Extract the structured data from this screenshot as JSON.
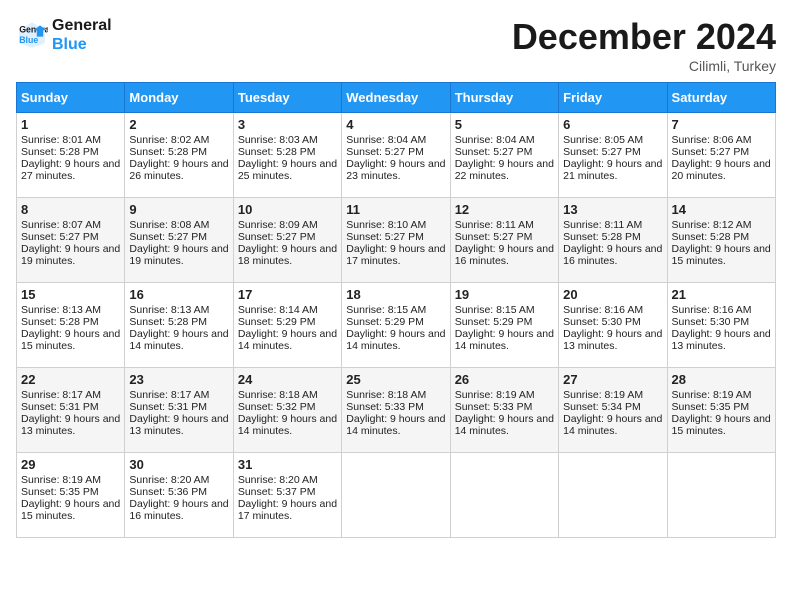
{
  "header": {
    "logo_line1": "General",
    "logo_line2": "Blue",
    "month": "December 2024",
    "location": "Cilimli, Turkey"
  },
  "weekdays": [
    "Sunday",
    "Monday",
    "Tuesday",
    "Wednesday",
    "Thursday",
    "Friday",
    "Saturday"
  ],
  "weeks": [
    [
      {
        "day": "1",
        "sr": "8:01 AM",
        "ss": "5:28 PM",
        "dl": "9 hours and 27 minutes."
      },
      {
        "day": "2",
        "sr": "8:02 AM",
        "ss": "5:28 PM",
        "dl": "9 hours and 26 minutes."
      },
      {
        "day": "3",
        "sr": "8:03 AM",
        "ss": "5:28 PM",
        "dl": "9 hours and 25 minutes."
      },
      {
        "day": "4",
        "sr": "8:04 AM",
        "ss": "5:27 PM",
        "dl": "9 hours and 23 minutes."
      },
      {
        "day": "5",
        "sr": "8:04 AM",
        "ss": "5:27 PM",
        "dl": "9 hours and 22 minutes."
      },
      {
        "day": "6",
        "sr": "8:05 AM",
        "ss": "5:27 PM",
        "dl": "9 hours and 21 minutes."
      },
      {
        "day": "7",
        "sr": "8:06 AM",
        "ss": "5:27 PM",
        "dl": "9 hours and 20 minutes."
      }
    ],
    [
      {
        "day": "8",
        "sr": "8:07 AM",
        "ss": "5:27 PM",
        "dl": "9 hours and 19 minutes."
      },
      {
        "day": "9",
        "sr": "8:08 AM",
        "ss": "5:27 PM",
        "dl": "9 hours and 19 minutes."
      },
      {
        "day": "10",
        "sr": "8:09 AM",
        "ss": "5:27 PM",
        "dl": "9 hours and 18 minutes."
      },
      {
        "day": "11",
        "sr": "8:10 AM",
        "ss": "5:27 PM",
        "dl": "9 hours and 17 minutes."
      },
      {
        "day": "12",
        "sr": "8:11 AM",
        "ss": "5:27 PM",
        "dl": "9 hours and 16 minutes."
      },
      {
        "day": "13",
        "sr": "8:11 AM",
        "ss": "5:28 PM",
        "dl": "9 hours and 16 minutes."
      },
      {
        "day": "14",
        "sr": "8:12 AM",
        "ss": "5:28 PM",
        "dl": "9 hours and 15 minutes."
      }
    ],
    [
      {
        "day": "15",
        "sr": "8:13 AM",
        "ss": "5:28 PM",
        "dl": "9 hours and 15 minutes."
      },
      {
        "day": "16",
        "sr": "8:13 AM",
        "ss": "5:28 PM",
        "dl": "9 hours and 14 minutes."
      },
      {
        "day": "17",
        "sr": "8:14 AM",
        "ss": "5:29 PM",
        "dl": "9 hours and 14 minutes."
      },
      {
        "day": "18",
        "sr": "8:15 AM",
        "ss": "5:29 PM",
        "dl": "9 hours and 14 minutes."
      },
      {
        "day": "19",
        "sr": "8:15 AM",
        "ss": "5:29 PM",
        "dl": "9 hours and 14 minutes."
      },
      {
        "day": "20",
        "sr": "8:16 AM",
        "ss": "5:30 PM",
        "dl": "9 hours and 13 minutes."
      },
      {
        "day": "21",
        "sr": "8:16 AM",
        "ss": "5:30 PM",
        "dl": "9 hours and 13 minutes."
      }
    ],
    [
      {
        "day": "22",
        "sr": "8:17 AM",
        "ss": "5:31 PM",
        "dl": "9 hours and 13 minutes."
      },
      {
        "day": "23",
        "sr": "8:17 AM",
        "ss": "5:31 PM",
        "dl": "9 hours and 13 minutes."
      },
      {
        "day": "24",
        "sr": "8:18 AM",
        "ss": "5:32 PM",
        "dl": "9 hours and 14 minutes."
      },
      {
        "day": "25",
        "sr": "8:18 AM",
        "ss": "5:33 PM",
        "dl": "9 hours and 14 minutes."
      },
      {
        "day": "26",
        "sr": "8:19 AM",
        "ss": "5:33 PM",
        "dl": "9 hours and 14 minutes."
      },
      {
        "day": "27",
        "sr": "8:19 AM",
        "ss": "5:34 PM",
        "dl": "9 hours and 14 minutes."
      },
      {
        "day": "28",
        "sr": "8:19 AM",
        "ss": "5:35 PM",
        "dl": "9 hours and 15 minutes."
      }
    ],
    [
      {
        "day": "29",
        "sr": "8:19 AM",
        "ss": "5:35 PM",
        "dl": "9 hours and 15 minutes."
      },
      {
        "day": "30",
        "sr": "8:20 AM",
        "ss": "5:36 PM",
        "dl": "9 hours and 16 minutes."
      },
      {
        "day": "31",
        "sr": "8:20 AM",
        "ss": "5:37 PM",
        "dl": "9 hours and 17 minutes."
      },
      null,
      null,
      null,
      null
    ]
  ],
  "labels": {
    "sunrise": "Sunrise:",
    "sunset": "Sunset:",
    "daylight": "Daylight:"
  }
}
